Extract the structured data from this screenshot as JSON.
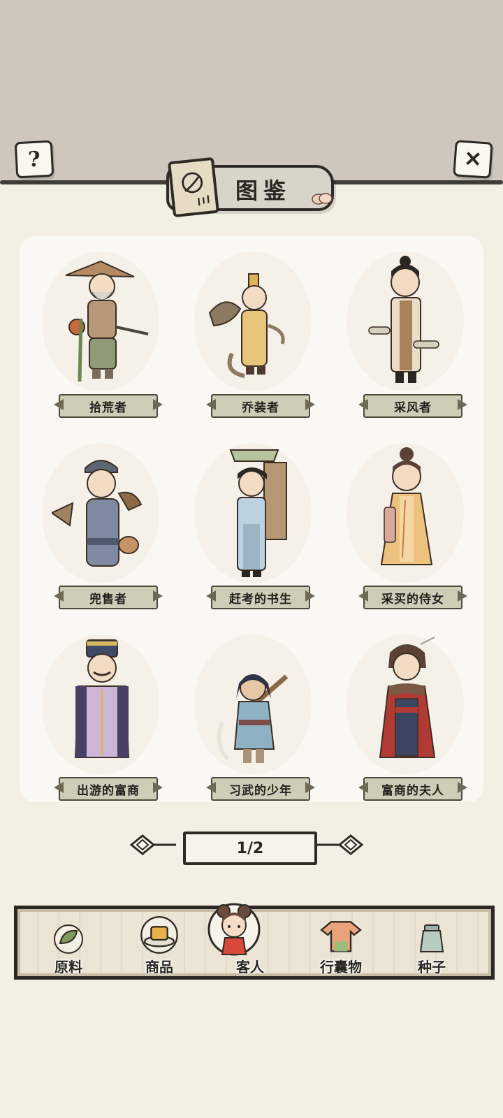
{
  "header": {
    "title": "图鉴",
    "help_symbol": "?",
    "close_symbol": "✕"
  },
  "characters": [
    {
      "name": "拾荒者"
    },
    {
      "name": "乔装者"
    },
    {
      "name": "采风者"
    },
    {
      "name": "兜售者"
    },
    {
      "name": "赶考的书生"
    },
    {
      "name": "采买的侍女"
    },
    {
      "name": "出游的富商"
    },
    {
      "name": "习武的少年"
    },
    {
      "name": "富商的夫人"
    }
  ],
  "pagination": {
    "label": "1/2"
  },
  "bottom_tabs": [
    {
      "label": "原料",
      "icon": "leaf-icon"
    },
    {
      "label": "商品",
      "icon": "tofu-plate-icon"
    },
    {
      "label": "客人",
      "icon": "guest-girl-icon",
      "active": true
    },
    {
      "label": "行囊物",
      "icon": "robe-icon"
    },
    {
      "label": "种子",
      "icon": "seed-jar-icon"
    }
  ]
}
